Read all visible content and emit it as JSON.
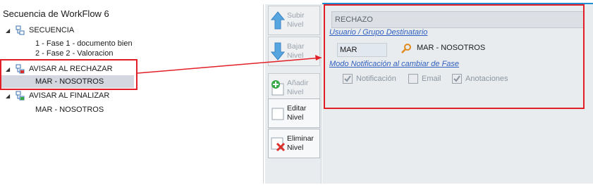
{
  "tree": {
    "title": "Secuencia de WorkFlow 6",
    "nodes": [
      {
        "label": "SECUENCIA",
        "expander": "◢"
      },
      {
        "label": "1 - Fase 1 - documento bien"
      },
      {
        "label": "2 - Fase 2 - Valoracion"
      },
      {
        "label": "AVISAR AL RECHAZAR",
        "expander": "◢"
      },
      {
        "label": "MAR - NOSOTROS"
      },
      {
        "label": "AVISAR AL FINALIZAR",
        "expander": "◢"
      },
      {
        "label": "MAR - NOSOTROS"
      }
    ]
  },
  "toolbar": {
    "subir": "Subir\nNivel",
    "bajar": "Bajar\nNivel",
    "anadir": "Añadir\nNivel",
    "editar": "Editar\nNivel",
    "eliminar": "Eliminar\nNivel"
  },
  "detail": {
    "section_title": "RECHAZO",
    "destinatario_label": "Usuario / Grupo Destinatario",
    "destinatario_code": "MAR",
    "destinatario_name": "MAR - NOSOTROS",
    "modo_label": "Modo Notificación al cambiar de Fase",
    "checks": [
      {
        "label": "Notificación",
        "checked": true
      },
      {
        "label": "Email",
        "checked": false
      },
      {
        "label": "Anotaciones",
        "checked": true
      }
    ]
  },
  "colors": {
    "accent": "#1f8ed0",
    "highlight_frame": "#e21f26",
    "selected_row": "#d4d6e0"
  }
}
